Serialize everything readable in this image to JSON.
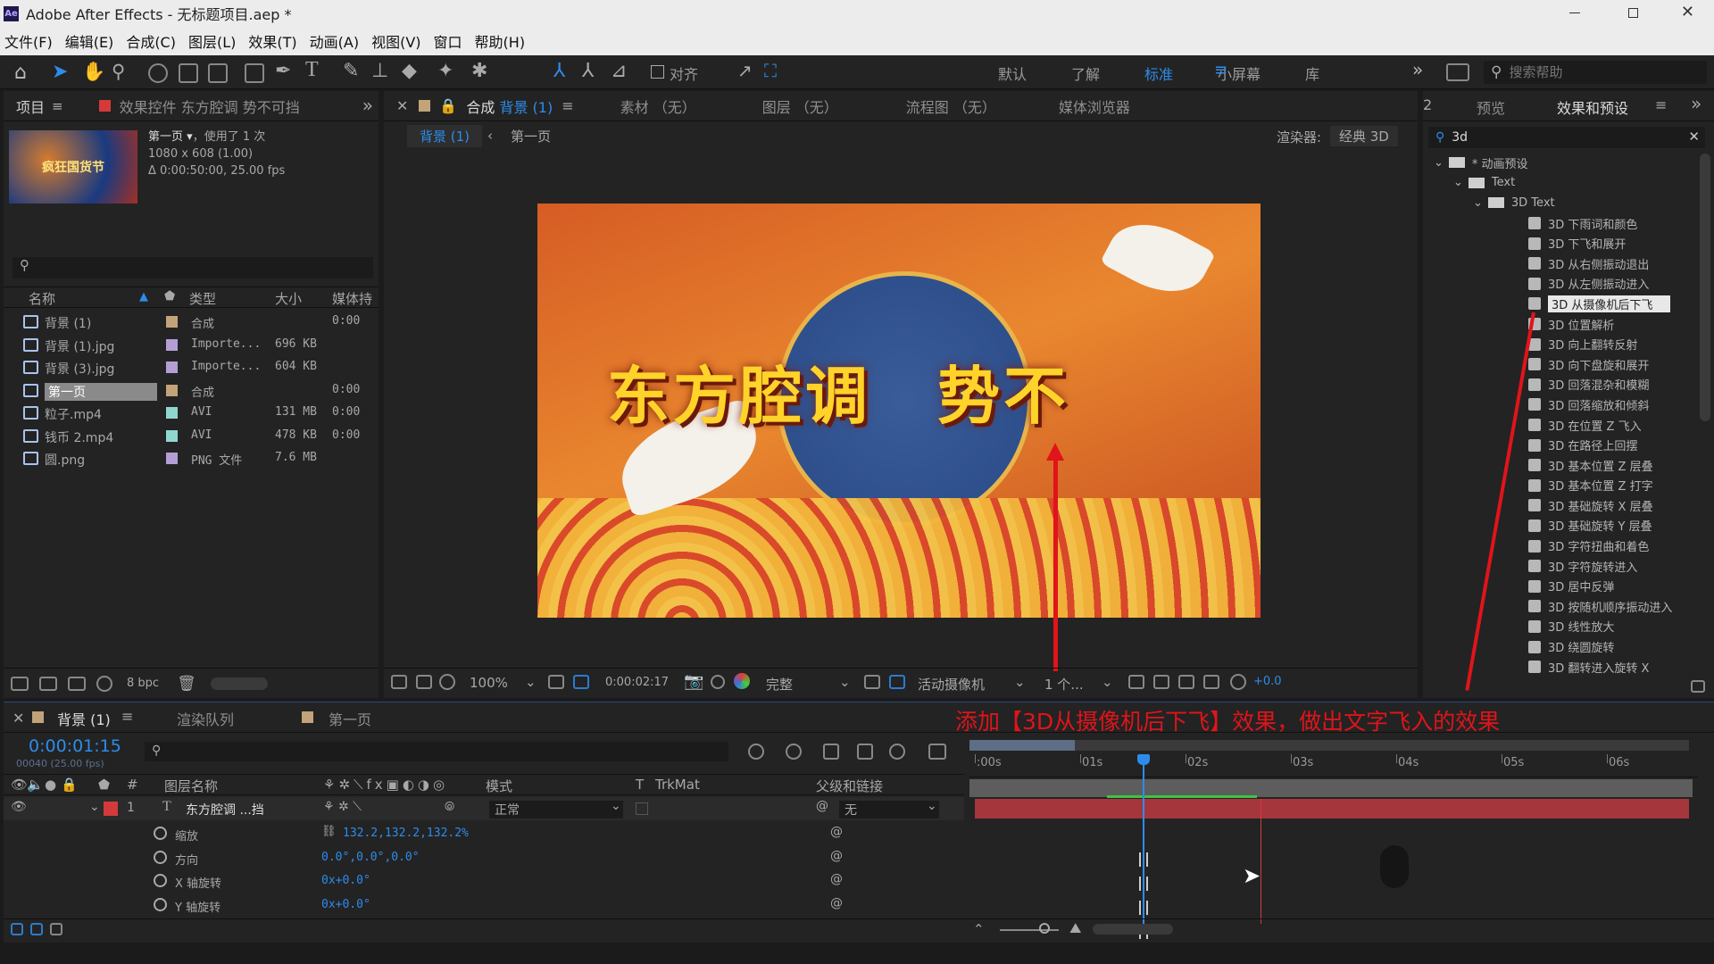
{
  "window": {
    "app_logo": "Ae",
    "title": "Adobe After Effects - 无标题项目.aep *"
  },
  "menu": [
    "文件(F)",
    "编辑(E)",
    "合成(C)",
    "图层(L)",
    "效果(T)",
    "动画(A)",
    "视图(V)",
    "窗口",
    "帮助(H)"
  ],
  "toolbar": {
    "align": "对齐",
    "workspaces": [
      "默认",
      "了解",
      "标准",
      "小屏幕",
      "库"
    ],
    "active_ws": "标准",
    "search_placeholder": "搜索帮助"
  },
  "project": {
    "tabs": [
      "项目",
      "效果控件 东方腔调  势不可挡"
    ],
    "comp_name": "第一页",
    "used": "，使用了 1 次",
    "size": "1080 x 608 (1.00)",
    "duration": "Δ 0:00:50:00, 25.00 fps",
    "thumb_text": "疯狂国货节",
    "columns": [
      "名称",
      "类型",
      "大小",
      "媒体持"
    ],
    "items": [
      {
        "name": "背景 (1)",
        "type": "合成",
        "size": "",
        "dur": "0:00",
        "color": "#c2a37a",
        "sel": false
      },
      {
        "name": "背景 (1).jpg",
        "type": "Importe...",
        "size": "696 KB",
        "dur": "",
        "color": "#b49ed6",
        "sel": false
      },
      {
        "name": "背景 (3).jpg",
        "type": "Importe...",
        "size": "604 KB",
        "dur": "",
        "color": "#b49ed6",
        "sel": false
      },
      {
        "name": "第一页",
        "type": "合成",
        "size": "",
        "dur": "0:00",
        "color": "#c2a37a",
        "sel": true
      },
      {
        "name": "粒子.mp4",
        "type": "AVI",
        "size": "131 MB",
        "dur": "0:00",
        "color": "#8fd6d0",
        "sel": false
      },
      {
        "name": "钱币 2.mp4",
        "type": "AVI",
        "size": "478 KB",
        "dur": "0:00",
        "color": "#8fd6d0",
        "sel": false
      },
      {
        "name": "圆.png",
        "type": "PNG 文件",
        "size": "7.6 MB",
        "dur": "",
        "color": "#b49ed6",
        "sel": false
      }
    ],
    "bpc": "8 bpc"
  },
  "comp": {
    "tabs": [
      "合成 背景 (1)",
      "素材 （无）",
      "图层 （无）",
      "流程图 （无）",
      "媒体浏览器"
    ],
    "active_tab_prefix": "合成",
    "active_tab_name": "背景 (1)",
    "breadcrumb": [
      "背景 (1)",
      "第一页"
    ],
    "renderer_label": "渲染器:",
    "renderer_value": "经典 3D",
    "frame_text": "东方腔调　势不",
    "zoom": "100%",
    "timecode": "0:00:02:17",
    "quality": "完整",
    "camera": "活动摄像机",
    "views": "1 个...",
    "exposure": "+0.0"
  },
  "effects": {
    "tabs": [
      "预览",
      "效果和预设"
    ],
    "search": "3d",
    "tree": [
      {
        "label": "* 动画预设",
        "depth": 0,
        "type": "folder"
      },
      {
        "label": "Text",
        "depth": 1,
        "type": "folder"
      },
      {
        "label": "3D Text",
        "depth": 2,
        "type": "folder"
      },
      {
        "label": "3D 下雨词和颜色",
        "depth": 3,
        "type": "fx"
      },
      {
        "label": "3D 下飞和展开",
        "depth": 3,
        "type": "fx"
      },
      {
        "label": "3D 从右侧振动退出",
        "depth": 3,
        "type": "fx"
      },
      {
        "label": "3D 从左侧振动进入",
        "depth": 3,
        "type": "fx"
      },
      {
        "label": "3D 从摄像机后下飞",
        "depth": 3,
        "type": "fx",
        "sel": true
      },
      {
        "label": "3D 位置解析",
        "depth": 3,
        "type": "fx"
      },
      {
        "label": "3D 向上翻转反射",
        "depth": 3,
        "type": "fx"
      },
      {
        "label": "3D 向下盘旋和展开",
        "depth": 3,
        "type": "fx"
      },
      {
        "label": "3D 回落混杂和模糊",
        "depth": 3,
        "type": "fx"
      },
      {
        "label": "3D 回落缩放和倾斜",
        "depth": 3,
        "type": "fx"
      },
      {
        "label": "3D 在位置 Z 飞入",
        "depth": 3,
        "type": "fx"
      },
      {
        "label": "3D 在路径上回摆",
        "depth": 3,
        "type": "fx"
      },
      {
        "label": "3D 基本位置 Z 层叠",
        "depth": 3,
        "type": "fx"
      },
      {
        "label": "3D 基本位置 Z 打字",
        "depth": 3,
        "type": "fx"
      },
      {
        "label": "3D 基础旋转 X 层叠",
        "depth": 3,
        "type": "fx"
      },
      {
        "label": "3D 基础旋转 Y 层叠",
        "depth": 3,
        "type": "fx"
      },
      {
        "label": "3D 字符扭曲和着色",
        "depth": 3,
        "type": "fx"
      },
      {
        "label": "3D 字符旋转进入",
        "depth": 3,
        "type": "fx"
      },
      {
        "label": "3D 居中反弹",
        "depth": 3,
        "type": "fx"
      },
      {
        "label": "3D 按随机顺序振动进入",
        "depth": 3,
        "type": "fx"
      },
      {
        "label": "3D 线性放大",
        "depth": 3,
        "type": "fx"
      },
      {
        "label": "3D 绕圆旋转",
        "depth": 3,
        "type": "fx"
      },
      {
        "label": "3D 翻转进入旋转 X",
        "depth": 3,
        "type": "fx"
      }
    ]
  },
  "timeline": {
    "tabs": [
      "背景 (1)",
      "渲染队列",
      "第一页"
    ],
    "timecode": "0:00:01:15",
    "frameinfo": "00040 (25.00 fps)",
    "annotation": "添加【3D从摄像机后下飞】效果，做出文字飞入的效果",
    "col_layer": "图层名称",
    "col_mode": "模式",
    "col_t": "T",
    "col_trkmat": "TrkMat",
    "col_parent": "父级和链接",
    "ruler": [
      ":00s",
      "01s",
      "02s",
      "03s",
      "04s",
      "05s",
      "06s"
    ],
    "layer": {
      "num": "1",
      "name": "东方腔调  ...挡",
      "mode": "正常",
      "parent": "无",
      "color": "#d43a3a"
    },
    "props": [
      {
        "name": "缩放",
        "value": "132.2,132.2,132.2%"
      },
      {
        "name": "方向",
        "value": "0.0°,0.0°,0.0°"
      },
      {
        "name": "X 轴旋转",
        "value": "0x+0.0°"
      },
      {
        "name": "Y 轴旋转",
        "value": "0x+0.0°"
      }
    ]
  }
}
